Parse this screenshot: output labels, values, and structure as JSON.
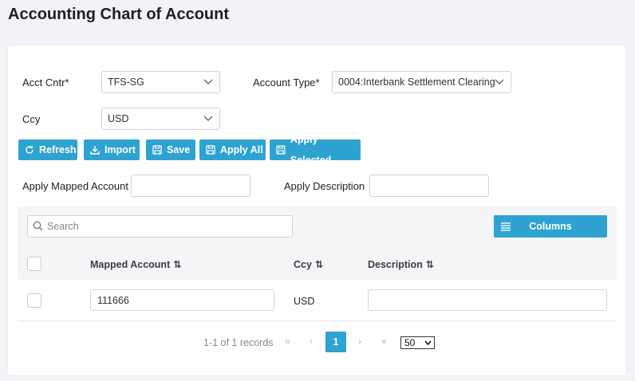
{
  "page": {
    "title": "Accounting Chart of Account"
  },
  "filters": {
    "acct_cntr_label": "Acct Cntr*",
    "acct_cntr_value": "TFS-SG",
    "account_type_label": "Account Type*",
    "account_type_value": "0004:Interbank Settlement Clearing",
    "ccy_label": "Ccy",
    "ccy_value": "USD"
  },
  "toolbar": {
    "refresh": "Refresh",
    "import": "Import",
    "save": "Save",
    "apply_all": "Apply All",
    "apply_selected": "Apply Selected"
  },
  "apply": {
    "mapped_account_label": "Apply Mapped Account",
    "mapped_account_value": "",
    "description_label": "Apply Description",
    "description_value": ""
  },
  "grid": {
    "search_placeholder": "Search",
    "columns_label": "Columns",
    "headers": [
      "Mapped Account",
      "Ccy",
      "Description"
    ],
    "sort_icon": "⇅",
    "rows": [
      {
        "mapped_account": "111666",
        "ccy": "USD",
        "description": ""
      }
    ]
  },
  "pagination": {
    "summary": "1-1 of 1 records",
    "first": "«",
    "prev": "‹",
    "current_page": "1",
    "next": "›",
    "last": "»",
    "page_size": "50"
  },
  "colors": {
    "accent": "#2ea3d1",
    "background": "#f1f3f6"
  }
}
